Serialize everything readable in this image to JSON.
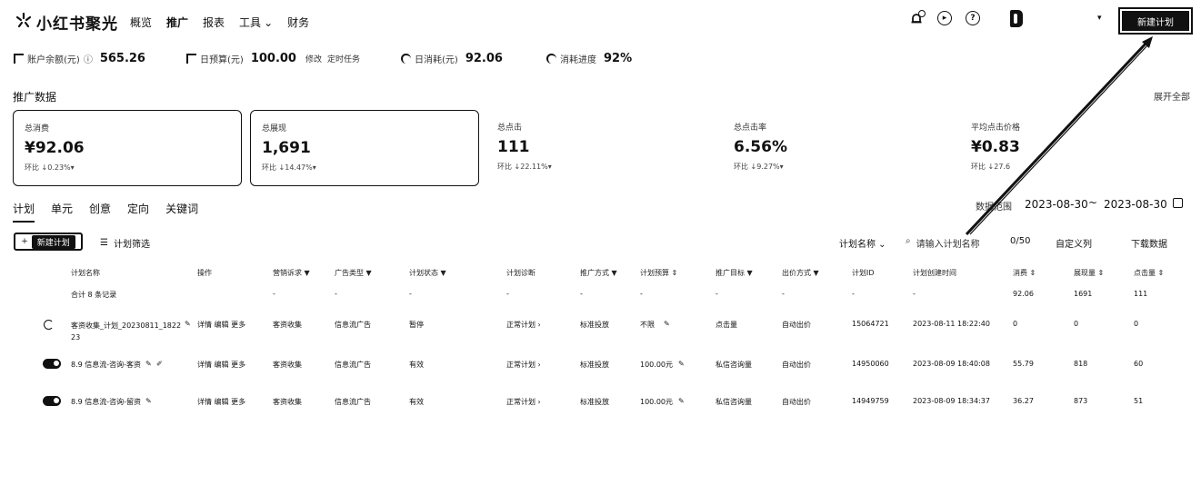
{
  "brand": {
    "name": "小红书聚光"
  },
  "nav": {
    "items": [
      "概览",
      "推广",
      "报表",
      "工具",
      "财务"
    ],
    "tools_caret": "⌄"
  },
  "header": {
    "acct_caret": "▾",
    "create_label": "新建计划"
  },
  "stats": {
    "balance_label": "账户余额(元)",
    "balance_value": "565.26",
    "budget_label": "日预算(元)",
    "budget_value": "100.00",
    "budget_edit": "修改",
    "budget_task": "定时任务",
    "spend_label": "日消耗(元)",
    "spend_value": "92.06",
    "progress_label": "消耗进度",
    "progress_value": "92%"
  },
  "section": {
    "title": "推广数据",
    "export_all": "展开全部"
  },
  "kpis": [
    {
      "label": "总消费",
      "value": "¥92.06",
      "compare": "环比 ↓0.23%▾"
    },
    {
      "label": "总展现",
      "value": "1,691",
      "compare": "环比 ↓14.47%▾"
    },
    {
      "label": "总点击",
      "value": "111",
      "compare": "环比 ↓22.11%▾"
    },
    {
      "label": "总点击率",
      "value": "6.56%",
      "compare": "环比 ↓9.27%▾"
    },
    {
      "label": "平均点击价格",
      "value": "¥0.83",
      "compare": "环比 ↓27.6"
    }
  ],
  "tabs": [
    "计划",
    "单元",
    "创意",
    "定向",
    "关键词"
  ],
  "date_range": {
    "label": "数据范围",
    "start": "2023-08-30",
    "sep": "~",
    "end": "2023-08-30"
  },
  "toolbar": {
    "new_label": "新建计划",
    "filter_label": "计划筛选",
    "field_select": "计划名称 ⌄",
    "search_placeholder": "请输入计划名称",
    "counter": "0/50",
    "custom_columns": "自定义列",
    "download": "下载数据"
  },
  "table": {
    "headers": [
      "计划名称",
      "操作",
      "营销诉求 ▼",
      "广告类型 ▼",
      "计划状态 ▼",
      "计划诊断",
      "推广方式 ▼",
      "计划预算 ⇕",
      "推广目标 ▼",
      "出价方式 ▼",
      "计划ID",
      "计划创建时间",
      "消费 ⇕",
      "展现量 ⇕",
      "点击量 ⇕"
    ],
    "summary": [
      "合计 8 条记录",
      "",
      "-",
      "-",
      "-",
      "-",
      "-",
      "-",
      "-",
      "-",
      "-",
      "-",
      "92.06",
      "1691",
      "111"
    ],
    "rows": [
      [
        "客资收集_计划_20230811_182223",
        "详情  编辑  更多",
        "客资收集",
        "信息流广告",
        "暂停",
        "正常计划 ›",
        "标准投放",
        "不限",
        "点击量",
        "自动出价",
        "15064721",
        "2023-08-11 18:22:40",
        "0",
        "0",
        "0"
      ],
      [
        "8.9 信息流-咨询-客资",
        "详情  编辑  更多",
        "客资收集",
        "信息流广告",
        "有效",
        "正常计划 ›",
        "标准投放",
        "100.00元",
        "私信咨询量",
        "自动出价",
        "14950060",
        "2023-08-09 18:40:08",
        "55.79",
        "818",
        "60"
      ],
      [
        "8.9 信息流-咨询-留资",
        "详情  编辑  更多",
        "客资收集",
        "信息流广告",
        "有效",
        "正常计划 ›",
        "标准投放",
        "100.00元",
        "私信咨询量",
        "自动出价",
        "14949759",
        "2023-08-09 18:34:37",
        "36.27",
        "873",
        "51"
      ]
    ]
  }
}
